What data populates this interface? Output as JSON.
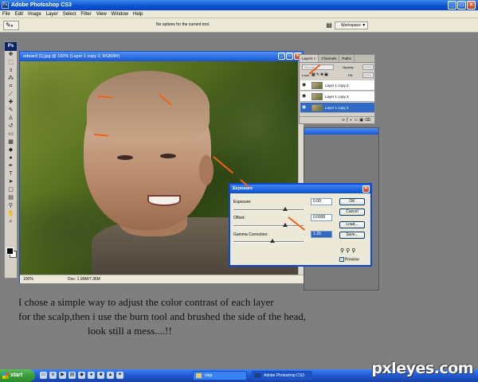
{
  "app": {
    "title": "Adobe Photoshop CS3",
    "icon": "Ps"
  },
  "menu": [
    "File",
    "Edit",
    "Image",
    "Layer",
    "Select",
    "Filter",
    "View",
    "Window",
    "Help"
  ],
  "options_bar": {
    "message": "No options for the current tool.",
    "workspace_label": "Workspace ▼"
  },
  "toolbox": {
    "header": "Ps"
  },
  "document": {
    "title": "edward [1].jpg @ 100% (Layer 1 copy 2, RGB/8#)",
    "zoom": "100%",
    "doc_info": "Doc: 1.90M/7.36M"
  },
  "layers_panel": {
    "tabs": [
      "Layers ×",
      "Channels",
      "Paths"
    ],
    "mode": "Normal",
    "opacity_label": "Opacity:",
    "opacity_value": "100%",
    "lock_label": "Lock:",
    "fill_label": "Fill:",
    "fill_value": "100%",
    "layers": [
      {
        "name": "Layer 1 copy 2",
        "selected": false
      },
      {
        "name": "Layer 1 copy 3",
        "selected": false
      },
      {
        "name": "Layer 1 copy 2",
        "selected": true
      }
    ]
  },
  "exposure_dialog": {
    "title": "Exposure",
    "exposure_label": "Exposure:",
    "exposure_value": "0.00",
    "offset_label": "Offset:",
    "offset_value": "0.0000",
    "gamma_label": "Gamma Correction:",
    "gamma_value": "1.39",
    "ok": "OK",
    "cancel": "Cancel",
    "load": "Load...",
    "save": "Save...",
    "preview_label": "Preview",
    "preview_checked": true
  },
  "caption": {
    "line1": "I chose a simple way to adjust the color contrast of each layer",
    "line2": "for the scalp,then i use the burn tool and brushed the side of the head,",
    "line3": "look still a mess....!!"
  },
  "taskbar": {
    "start": "start",
    "tasks": [
      "step",
      "Adobe Photoshop CS3"
    ]
  },
  "watermark": "pxleyes.com",
  "colors": {
    "accent": "#0a4fd3",
    "arrow": "#f0621a",
    "selection": "#316ac5"
  }
}
